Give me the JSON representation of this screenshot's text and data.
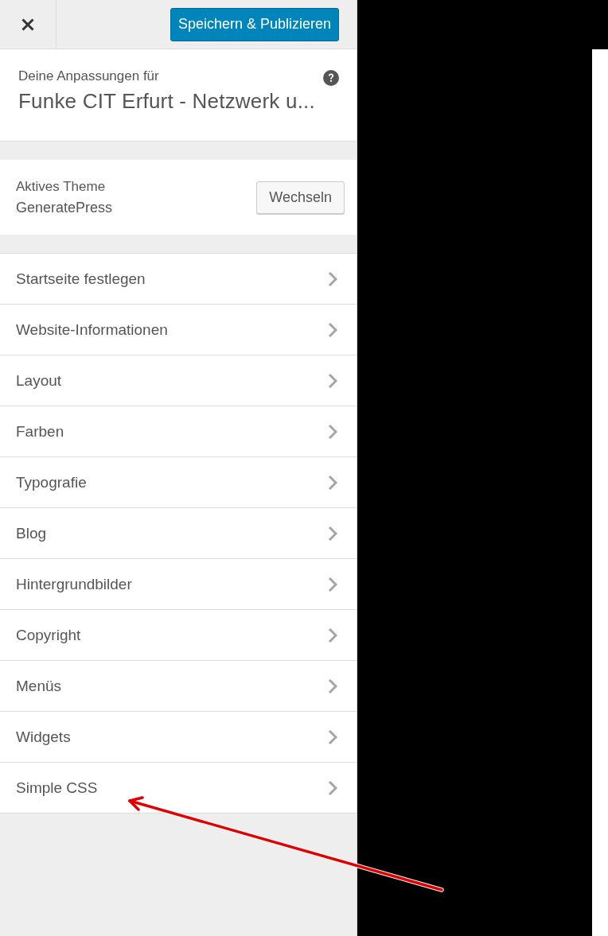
{
  "header": {
    "save_button": "Speichern & Publizieren"
  },
  "info": {
    "label": "Deine Anpassungen für",
    "title": "Funke CIT Erfurt - Netzwerk u..."
  },
  "theme": {
    "label": "Aktives Theme",
    "name": "GeneratePress",
    "button": "Wechseln"
  },
  "menu": {
    "items": [
      {
        "label": "Startseite festlegen"
      },
      {
        "label": "Website-Informationen"
      },
      {
        "label": "Layout"
      },
      {
        "label": "Farben"
      },
      {
        "label": "Typografie"
      },
      {
        "label": "Blog"
      },
      {
        "label": "Hintergrundbilder"
      },
      {
        "label": "Copyright"
      },
      {
        "label": "Menüs"
      },
      {
        "label": "Widgets"
      },
      {
        "label": "Simple CSS"
      }
    ]
  }
}
